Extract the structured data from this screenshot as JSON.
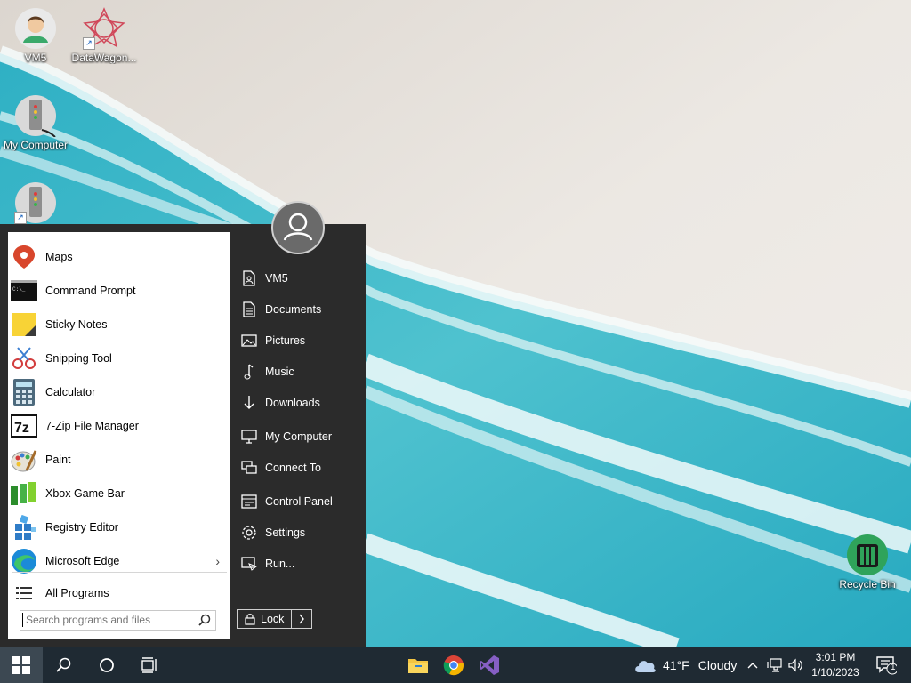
{
  "desktop": {
    "icons": [
      {
        "label": "VM5",
        "icon": "user-folder-icon"
      },
      {
        "label": "DataWagon...",
        "icon": "datawagon-app-icon"
      },
      {
        "label": "My Computer",
        "icon": "computer-icon"
      },
      {
        "label": "",
        "icon": "computer-shortcut-icon"
      },
      {
        "label": "Recycle Bin",
        "icon": "recycle-bin-icon"
      }
    ]
  },
  "start_menu": {
    "programs": [
      {
        "label": "Maps",
        "icon": "maps-icon"
      },
      {
        "label": "Command Prompt",
        "icon": "command-prompt-icon"
      },
      {
        "label": "Sticky Notes",
        "icon": "sticky-notes-icon"
      },
      {
        "label": "Snipping Tool",
        "icon": "snipping-tool-icon"
      },
      {
        "label": "Calculator",
        "icon": "calculator-icon"
      },
      {
        "label": "7-Zip File Manager",
        "icon": "7zip-icon"
      },
      {
        "label": "Paint",
        "icon": "paint-icon"
      },
      {
        "label": "Xbox Game Bar",
        "icon": "xbox-game-bar-icon"
      },
      {
        "label": "Registry Editor",
        "icon": "registry-editor-icon"
      },
      {
        "label": "Microsoft Edge",
        "icon": "edge-icon"
      }
    ],
    "all_programs": "All Programs",
    "search_placeholder": "Search programs and files",
    "right_links": [
      {
        "label": "VM5",
        "icon": "user-files-icon"
      },
      {
        "label": "Documents",
        "icon": "document-icon"
      },
      {
        "label": "Pictures",
        "icon": "pictures-icon"
      },
      {
        "label": "Music",
        "icon": "music-icon"
      },
      {
        "label": "Downloads",
        "icon": "download-icon"
      },
      {
        "label": "My Computer",
        "icon": "monitor-icon"
      },
      {
        "label": "Connect To",
        "icon": "connect-icon"
      },
      {
        "label": "Control Panel",
        "icon": "control-panel-icon"
      },
      {
        "label": "Settings",
        "icon": "gear-icon"
      },
      {
        "label": "Run...",
        "icon": "run-icon"
      }
    ],
    "lock_label": "Lock"
  },
  "taskbar": {
    "pinned": [
      "file-explorer-icon",
      "chrome-icon",
      "visual-studio-icon"
    ],
    "weather": {
      "temp": "41°F",
      "condition": "Cloudy"
    },
    "clock": {
      "time": "3:01 PM",
      "date": "1/10/2023"
    },
    "notification_count": "1"
  },
  "colors": {
    "taskbar": "#1f2a33",
    "start_menu_dark": "#2b2b2b",
    "start_menu_light": "#ffffff",
    "sea": "#3fb7c6"
  }
}
